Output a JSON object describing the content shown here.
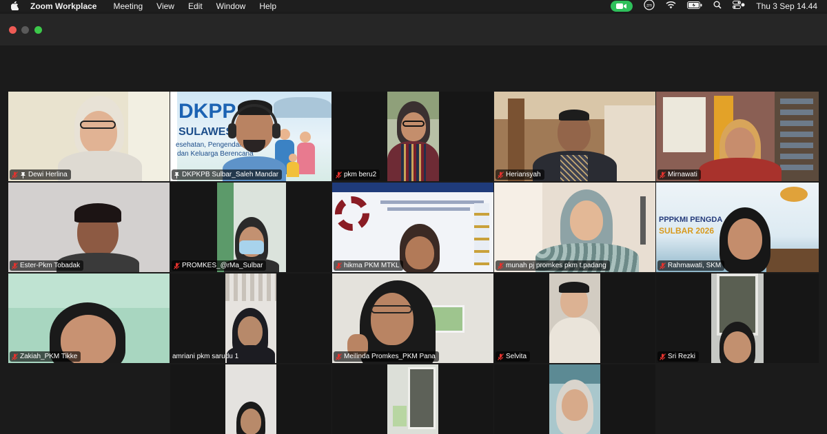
{
  "menubar": {
    "app_name": "Zoom Workplace",
    "items": [
      "Meeting",
      "View",
      "Edit",
      "Window",
      "Help"
    ],
    "zm_label": "zm",
    "clock": "Thu 3 Sep  14.44"
  },
  "colors": {
    "speaking_outline": "#2ec05b",
    "muted_red": "#e5322d",
    "window_bg": "#1b1b1b"
  },
  "tiles": [
    {
      "name": "Dewi Herlina",
      "muted": true,
      "pinned": true
    },
    {
      "name": "DKPKPB Sulbar_Saleh Mandar",
      "muted": false,
      "pinned": true,
      "speaking": true,
      "banner": {
        "line1": "DKPP",
        "line2": "SULAWESI",
        "line3": "esehatan, Pengendalian",
        "line4": "dan Keluarga Berencana"
      }
    },
    {
      "name": "pkm beru2",
      "muted": true,
      "pinned": false
    },
    {
      "name": "Heriansyah",
      "muted": true,
      "pinned": false
    },
    {
      "name": "Mirnawati",
      "muted": true,
      "pinned": false
    },
    {
      "name": "Ester-Pkm Tobadak",
      "muted": true,
      "pinned": false
    },
    {
      "name": "PROMKES_@rMa_Sulbar",
      "muted": true,
      "pinned": false
    },
    {
      "name": "hikma PKM MTKL",
      "muted": true,
      "pinned": false
    },
    {
      "name": "munah pj promkes pkm t.padang",
      "muted": true,
      "pinned": false
    },
    {
      "name": "Rahmawati, SKM",
      "muted": true,
      "pinned": false,
      "banner": {
        "line1": "PPPKMI PENGDA",
        "line2": "SULBAR 2026"
      }
    },
    {
      "name": "Zakiah_PKM Tikke",
      "muted": true,
      "pinned": false
    },
    {
      "name": "amriani pkm sarudu 1",
      "muted": false,
      "pinned": false
    },
    {
      "name": "Meilinda Promkes_PKM Pana",
      "muted": true,
      "pinned": false
    },
    {
      "name": "Selvita",
      "muted": true,
      "pinned": false
    },
    {
      "name": "Sri Rezki",
      "muted": true,
      "pinned": false
    },
    {
      "name": "",
      "muted": false,
      "pinned": false
    },
    {
      "name": "",
      "muted": false,
      "pinned": false
    },
    {
      "name": "",
      "muted": false,
      "pinned": false
    },
    {
      "name": "",
      "muted": false,
      "pinned": false
    }
  ]
}
